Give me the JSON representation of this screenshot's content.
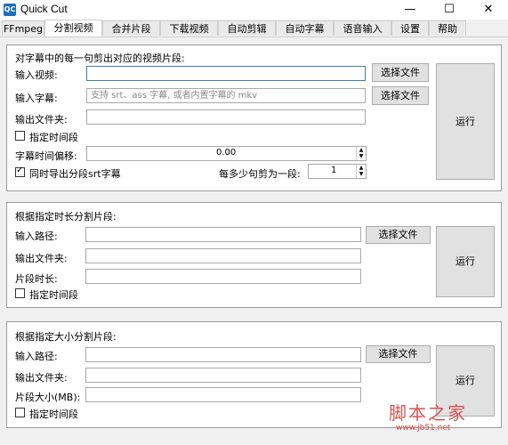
{
  "window": {
    "title": "Quick Cut",
    "icon_label": "QC",
    "min": "—",
    "max": "☐",
    "close": "✕"
  },
  "tabs": [
    "FFmpeg",
    "分割视频",
    "合并片段",
    "下载视频",
    "自动剪辑",
    "自动字幕",
    "语音输入",
    "设置",
    "帮助"
  ],
  "section1": {
    "title": "对字幕中的每一句剪出对应的视频片段:",
    "video_label": "输入视频:",
    "video_value": "",
    "subtitle_label": "输入字幕:",
    "subtitle_placeholder": "支持 srt、ass 字幕, 或者内置字幕的 mkv",
    "output_label": "输出文件夹:",
    "time_range_label": "指定时间段",
    "offset_label": "字幕时间偏移:",
    "offset_value": "0.00",
    "export_srt_label": "同时导出分段srt字幕",
    "per_segment_label": "每多少句剪为一段:",
    "per_segment_value": "1",
    "choose_file_1": "选择文件",
    "choose_file_2": "选择文件",
    "run": "运行"
  },
  "section2": {
    "title": "根据指定时长分割片段:",
    "input_label": "输入路径:",
    "output_label": "输出文件夹:",
    "duration_label": "片段时长:",
    "time_range_label": "指定时间段",
    "choose_file": "选择文件",
    "run": "运行"
  },
  "section3": {
    "title": "根据指定大小分割片段:",
    "input_label": "输入路径:",
    "output_label": "输出文件夹:",
    "size_label": "片段大小(MB):",
    "time_range_label": "指定时间段",
    "choose_file": "选择文件",
    "run": "运行"
  },
  "watermark": {
    "text": "脚本之家",
    "url": "www.jb51.net"
  }
}
